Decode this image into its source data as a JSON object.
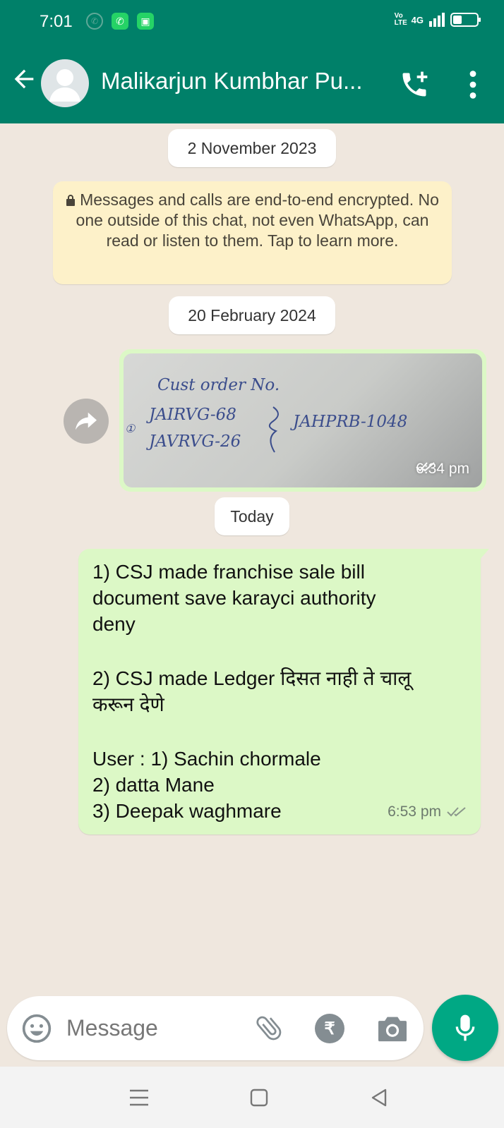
{
  "status_bar": {
    "time": "7:01",
    "network": "4G",
    "volte": "Vo LTE",
    "battery_level": 0.45
  },
  "header": {
    "contact_name": "Malikarjun Kumbhar Pu..."
  },
  "chat": {
    "date_chip_1": "2 November 2023",
    "encryption_notice": "Messages and calls are end-to-end encrypted. No one outside of this chat, not even WhatsApp, can read or listen to them. Tap to learn more.",
    "date_chip_2": "20 February 2024",
    "image_message": {
      "handwriting": {
        "line1": "Cust order No.",
        "line2a": "JAIRVG-68",
        "line2b": "JAHPRB-1048",
        "line3": "JAVRVG-26",
        "bullet": "①"
      },
      "time": "6:34 pm"
    },
    "date_chip_3": "Today",
    "text_message": {
      "line1": "1) CSJ made franchise sale bill",
      "line2": "document save karayci authority",
      "line3": "deny",
      "line4": "2) CSJ made Ledger दिसत नाही ते चालू",
      "line5": "करून देणे",
      "line6": "User : 1) Sachin chormale",
      "line7": "2) datta Mane",
      "line8": "3) Deepak waghmare",
      "time": "6:53 pm"
    }
  },
  "composer": {
    "placeholder": "Message",
    "rupee_symbol": "₹"
  },
  "colors": {
    "header": "#008069",
    "bubble_out": "#dcf8c6",
    "mic": "#00a884",
    "encryption_bg": "#fdf1c9"
  }
}
